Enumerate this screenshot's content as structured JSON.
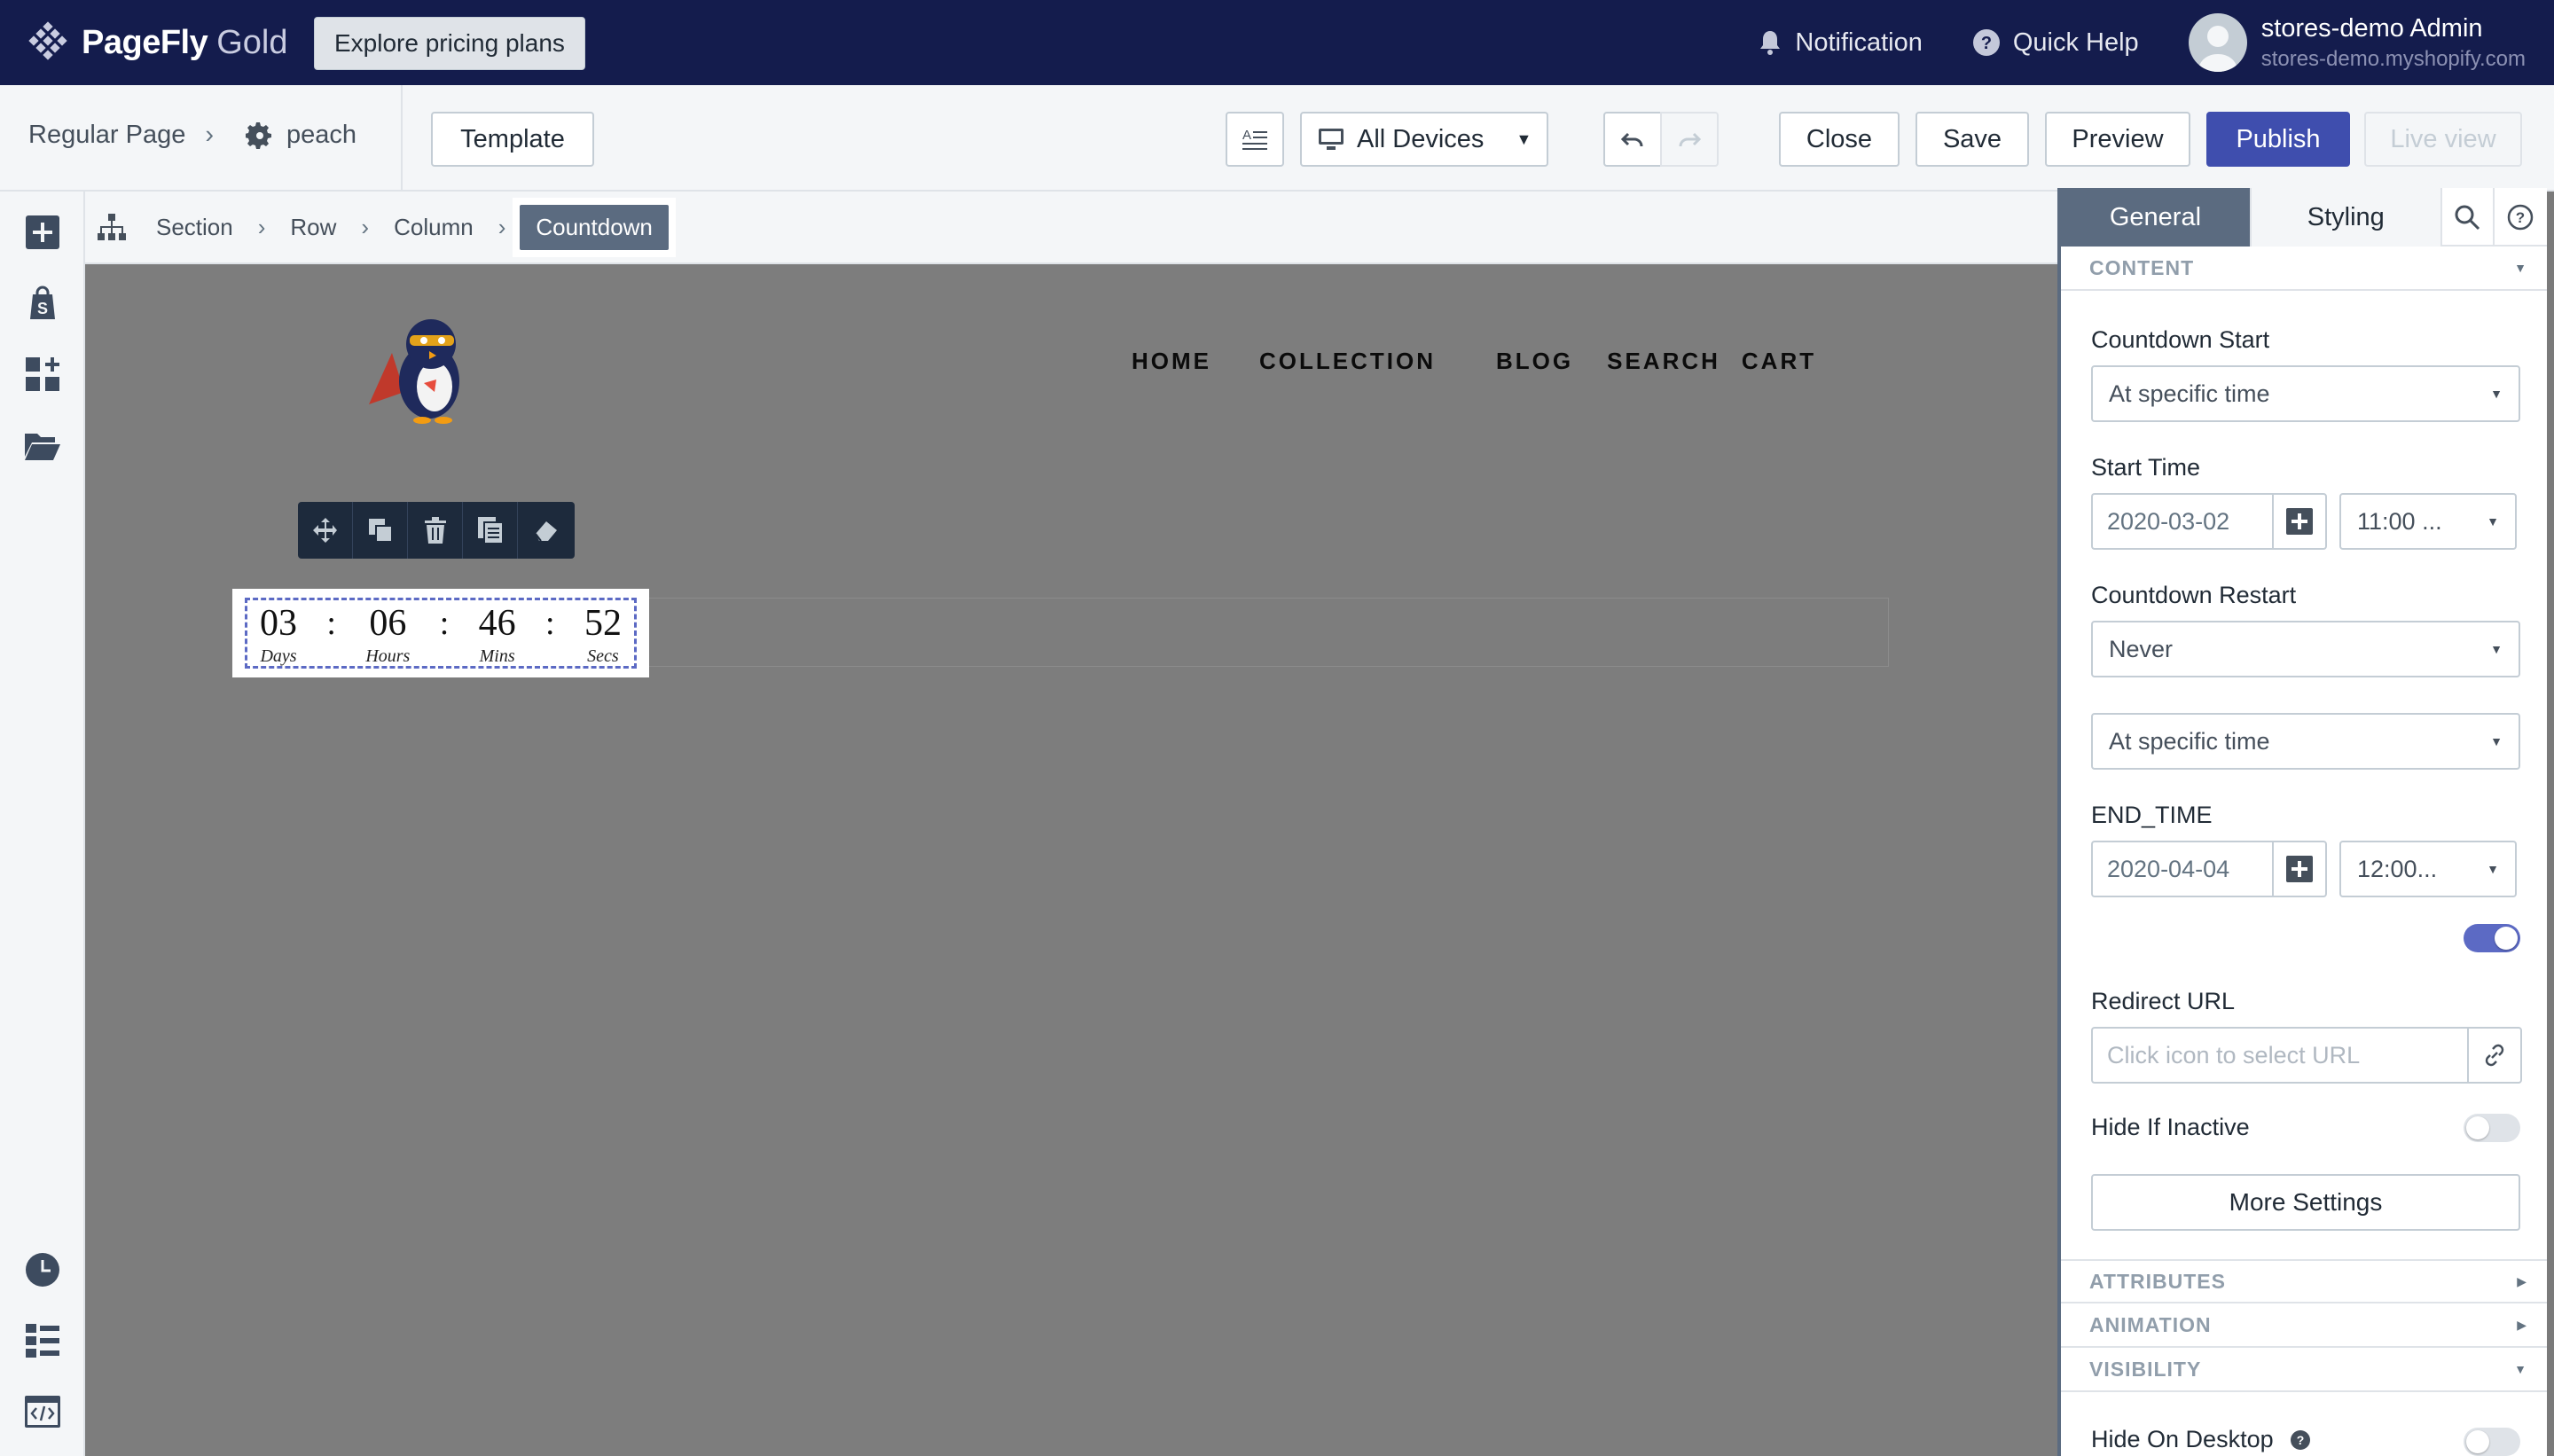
{
  "topbar": {
    "brand_name": "PageFly",
    "brand_tier": "Gold",
    "pricing_label": "Explore pricing plans",
    "notification_label": "Notification",
    "help_label": "Quick Help",
    "user_name": "stores-demo Admin",
    "user_store": "stores-demo.myshopify.com"
  },
  "toolbar": {
    "page_type": "Regular Page",
    "page_name": "peach",
    "template_label": "Template",
    "device_label": "All Devices",
    "close_label": "Close",
    "save_label": "Save",
    "preview_label": "Preview",
    "publish_label": "Publish",
    "liveview_label": "Live view"
  },
  "breadcrumb": {
    "items": [
      "Section",
      "Row",
      "Column"
    ],
    "active": "Countdown"
  },
  "store_nav": [
    "HOME",
    "COLLECTION",
    "BLOG",
    "SEARCH",
    "CART"
  ],
  "countdown": {
    "units": [
      {
        "value": "03",
        "label": "Days"
      },
      {
        "value": "06",
        "label": "Hours"
      },
      {
        "value": "46",
        "label": "Mins"
      },
      {
        "value": "52",
        "label": "Secs"
      }
    ],
    "separator": ":"
  },
  "panel": {
    "tab_general": "General",
    "tab_styling": "Styling",
    "content_header": "CONTENT",
    "countdown_start_label": "Countdown Start",
    "countdown_start_value": "At specific time",
    "start_time_label": "Start Time",
    "start_date": "2020-03-02",
    "start_clock": "11:00 ...",
    "restart_label": "Countdown Restart",
    "restart_value": "Never",
    "end_mode_value": "At specific time",
    "end_time_label": "END_TIME",
    "end_date": "2020-04-04",
    "end_clock": "12:00...",
    "redirect_toggle": true,
    "redirect_label": "Redirect URL",
    "redirect_placeholder": "Click icon to select URL",
    "hide_inactive_label": "Hide If Inactive",
    "hide_inactive": false,
    "more_settings_label": "More Settings",
    "attributes_header": "ATTRIBUTES",
    "animation_header": "ANIMATION",
    "visibility_header": "VISIBILITY",
    "hide_desktop_label": "Hide On Desktop",
    "hide_desktop": false
  },
  "colors": {
    "topbar": "#141c4d",
    "accent": "#3f4eae",
    "active_tab": "#5b6b80",
    "toggle_on": "#5c6ac4"
  }
}
